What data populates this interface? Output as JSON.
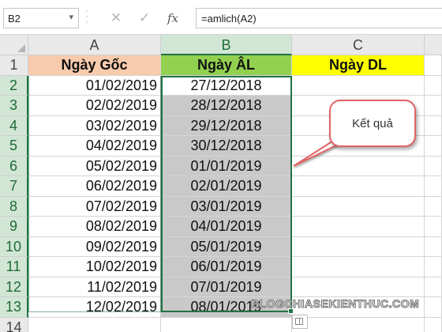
{
  "formula_bar": {
    "name_box": "B2",
    "name_box_dropdown_icon": "chevron-down-icon",
    "cancel_icon": "close-icon",
    "confirm_icon": "checkmark-icon",
    "fx_label": "fx",
    "formula": "=amlich(A2)"
  },
  "columns": {
    "corner_icon": "select-all-icon",
    "labels": [
      "A",
      "B",
      "C"
    ],
    "selected": "B"
  },
  "rows": {
    "labels": [
      "1",
      "2",
      "3",
      "4",
      "5",
      "6",
      "7",
      "8",
      "9",
      "10",
      "11",
      "12",
      "13",
      "14"
    ]
  },
  "table": {
    "headers": [
      "Ngày Gốc",
      "Ngày ÂL",
      "Ngày DL"
    ],
    "header_colors": [
      "#f8cbad",
      "#92d050",
      "#ffff00"
    ],
    "selected_fill": "#c9c9c9",
    "selection_color": "#217346",
    "col_a": [
      "01/02/2019",
      "02/02/2019",
      "03/02/2019",
      "04/02/2019",
      "05/02/2019",
      "06/02/2019",
      "07/02/2019",
      "08/02/2019",
      "09/02/2019",
      "10/02/2019",
      "11/02/2019",
      "12/02/2019"
    ],
    "col_b": [
      "27/12/2018",
      "28/12/2018",
      "29/12/2018",
      "30/12/2018",
      "01/01/2019",
      "02/01/2019",
      "03/01/2019",
      "04/01/2019",
      "05/01/2019",
      "06/01/2019",
      "07/01/2019",
      "08/01/2019"
    ]
  },
  "callout": {
    "text": "Kết quả",
    "color": "#e06363"
  },
  "watermark": "BLOGCHIASEKIENTHUC.COM",
  "quick_analysis_icon": "quick-analysis-icon"
}
